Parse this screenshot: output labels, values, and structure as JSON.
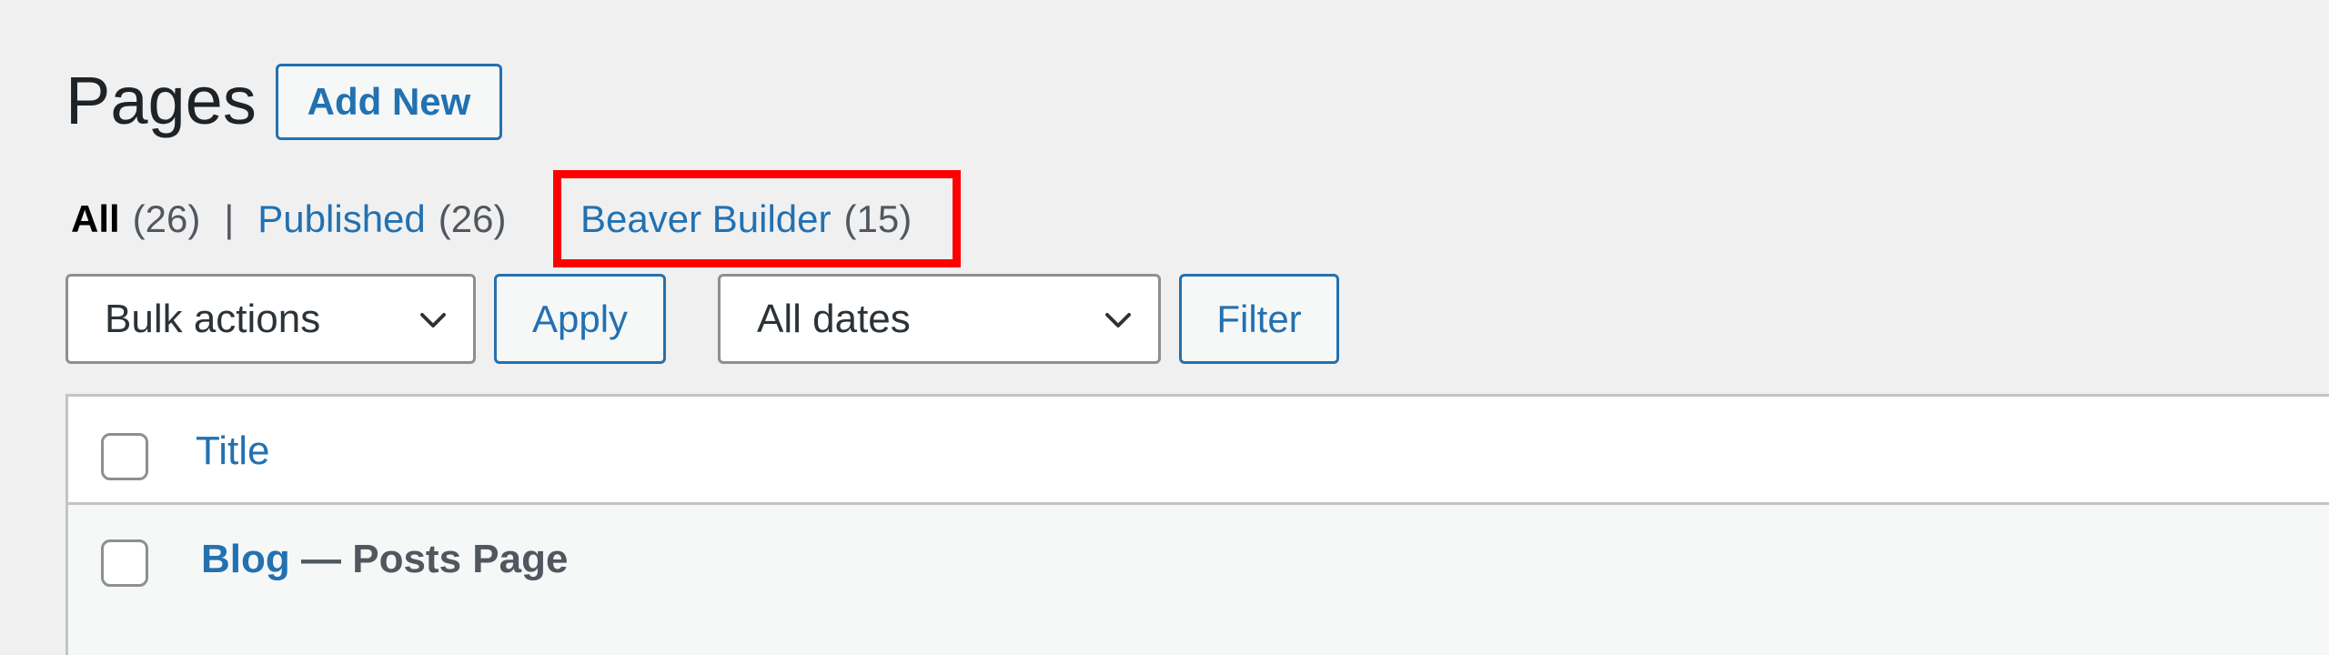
{
  "header": {
    "title": "Pages",
    "add_new_label": "Add New"
  },
  "views": {
    "all_label": "All",
    "all_count": "(26)",
    "separator": "|",
    "published_label": "Published",
    "published_count": "(26)",
    "beaver_label": "Beaver Builder",
    "beaver_count": "(15)"
  },
  "filters": {
    "bulk_actions": "Bulk actions",
    "apply_label": "Apply",
    "dates": "All dates",
    "filter_label": "Filter"
  },
  "table": {
    "column_title": "Title",
    "rows": [
      {
        "title": "Blog",
        "state": " — Posts Page"
      }
    ]
  },
  "colors": {
    "link": "#2271b1",
    "highlight": "#ff0000",
    "background": "#f0f0f1"
  }
}
